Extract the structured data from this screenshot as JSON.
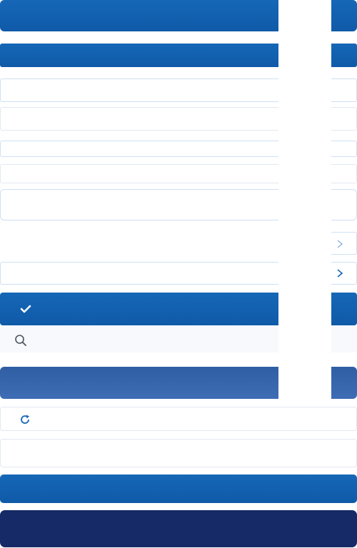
{
  "buttons": {
    "primary_1": "",
    "primary_2": "",
    "confirm": "",
    "secondary": "",
    "primary_3": "",
    "dark": ""
  },
  "fields": {
    "text_1": "",
    "text_2": "",
    "text_3": "",
    "text_4": "",
    "textarea": "",
    "select_1": "",
    "select_2": "",
    "search": "",
    "refresh": "",
    "text_5": ""
  },
  "icons": {
    "chevron": "chevron-right-icon",
    "check": "check-icon",
    "search": "search-icon",
    "refresh": "refresh-icon"
  },
  "colors": {
    "primary": "#1565b6",
    "primary_gradient_top": "#2a5ea8",
    "dark": "#152a66",
    "field_border": "#cfe0f3",
    "icon": "#1565b6"
  }
}
